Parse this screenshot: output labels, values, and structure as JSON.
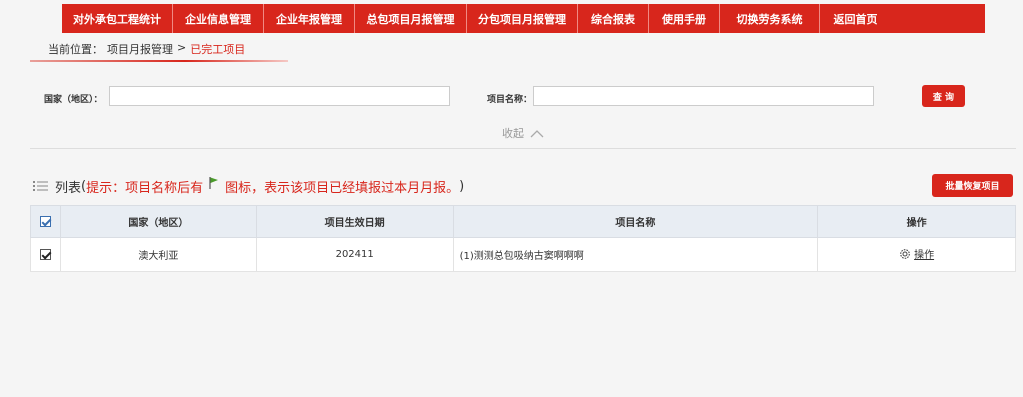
{
  "nav": {
    "items": [
      {
        "label": "对外承包工程统计"
      },
      {
        "label": "企业信息管理"
      },
      {
        "label": "企业年报管理"
      },
      {
        "label": "总包项目月报管理"
      },
      {
        "label": "分包项目月报管理"
      },
      {
        "label": "综合报表"
      },
      {
        "label": "使用手册"
      },
      {
        "label": "切换劳务系统"
      },
      {
        "label": "返回首页"
      }
    ],
    "accent_color": "#d8261c"
  },
  "breadcrumb": {
    "prefix": "当前位置：",
    "parent": "项目月报管理",
    "separator": ">",
    "current": "已完工项目"
  },
  "search": {
    "country_label": "国家（地区）：",
    "country_value": "",
    "project_label": "项目名称：",
    "project_value": "",
    "query_button": "查 询",
    "collapse_label": "收起"
  },
  "list": {
    "title": "列表",
    "hint_open": "(",
    "hint_text": "提示：项目名称后有",
    "hint_text2": "图标，表示该项目已经填报过本月月报。",
    "hint_close": ")",
    "batch_restore_button": "批量恢复项目",
    "icons": {
      "list": "list-icon",
      "flag": "flag-icon"
    }
  },
  "table": {
    "headers": [
      "国家（地区）",
      "项目生效日期",
      "项目名称",
      "操作"
    ],
    "rows": [
      {
        "checked": true,
        "country": "澳大利亚",
        "date": "202411",
        "name": "(1)测测总包吸纳古窦啊啊啊",
        "action": "操作"
      }
    ]
  }
}
